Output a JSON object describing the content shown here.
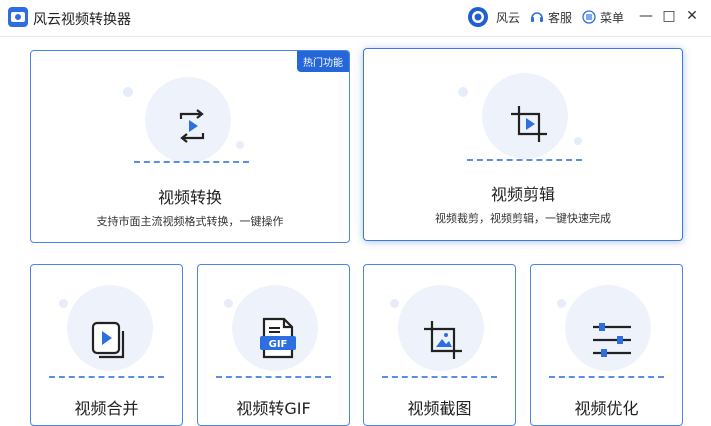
{
  "window": {
    "title": "风云视频转换器",
    "brand_label": "风云",
    "service_label": "客服",
    "menu_label": "菜单",
    "minimize": "—",
    "maximize": "□",
    "close": "✕"
  },
  "cards": {
    "convert": {
      "title": "视频转换",
      "desc": "支持市面主流视频格式转换，一键操作",
      "badge": "热门功能"
    },
    "edit": {
      "title": "视频剪辑",
      "desc": "视频裁剪，视频剪辑，一键快速完成"
    },
    "merge": {
      "title": "视频合并"
    },
    "gif": {
      "title": "视频转GIF",
      "icon_text": "GIF"
    },
    "crop": {
      "title": "视频截图"
    },
    "settings": {
      "title": "视频优化"
    }
  },
  "colors": {
    "accent": "#2d6fe0",
    "border": "#4a86e8"
  }
}
